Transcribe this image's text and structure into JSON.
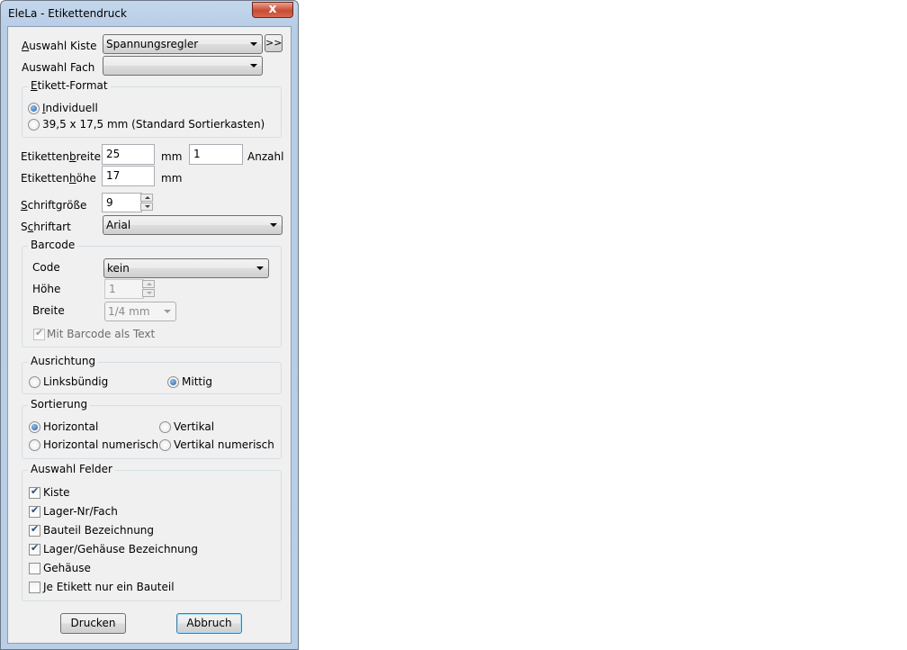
{
  "window": {
    "title": "EleLa - Etikettendruck",
    "close_glyph": "x"
  },
  "kiste": {
    "label_u": "A",
    "label_rest": "uswahl Kiste",
    "value": "Spannungsregler",
    "more_button": ">>"
  },
  "fach": {
    "label": "Auswahl Fach",
    "value": ""
  },
  "format": {
    "title_u": "E",
    "title_rest": "tikett-Format",
    "opt1_u": "I",
    "opt1_rest": "ndividuell",
    "opt2": "39,5 x 17,5 mm (Standard Sortierkasten)"
  },
  "breite": {
    "label_a": "Etiketten",
    "label_u": "b",
    "label_b": "reite",
    "value": "25",
    "unit": "mm"
  },
  "anzahl": {
    "value": "1",
    "label": "Anzahl"
  },
  "hoehe": {
    "label_a": "Etiketten",
    "label_u": "h",
    "label_b": "öhe",
    "value": "17",
    "unit": "mm"
  },
  "schriftgroesse": {
    "label_u": "S",
    "label_rest": "chriftgröße",
    "value": "9"
  },
  "schriftart": {
    "label_a": "S",
    "label_u": "c",
    "label_b": "hriftart",
    "value": "Arial"
  },
  "barcode": {
    "title": "Barcode",
    "code_label": "Code",
    "code_value": "kein",
    "hoehe_label": "Höhe",
    "hoehe_value": "1",
    "breite_label": "Breite",
    "breite_value": "1/4 mm",
    "mit_text": "Mit Barcode als Text"
  },
  "ausrichtung": {
    "title": "Ausrichtung",
    "left": "Linksbündig",
    "center": "Mittig"
  },
  "sortierung": {
    "title": "Sortierung",
    "h": "Horizontal",
    "v": "Vertikal",
    "hn": "Horizontal numerisch",
    "vn": "Vertikal numerisch"
  },
  "felder": {
    "title": "Auswahl Felder",
    "items": [
      {
        "label": "Kiste",
        "checked": true
      },
      {
        "label": "Lager-Nr/Fach",
        "checked": true
      },
      {
        "label": "Bauteil Bezeichnung",
        "checked": true
      },
      {
        "label": "Lager/Gehäuse Bezeichnung",
        "checked": true
      },
      {
        "label": "Gehäuse",
        "checked": false
      },
      {
        "label": "Je Etikett nur ein Bauteil",
        "checked": false
      }
    ]
  },
  "buttons": {
    "drucken": "Drucken",
    "abbruch": "Abbruch"
  }
}
